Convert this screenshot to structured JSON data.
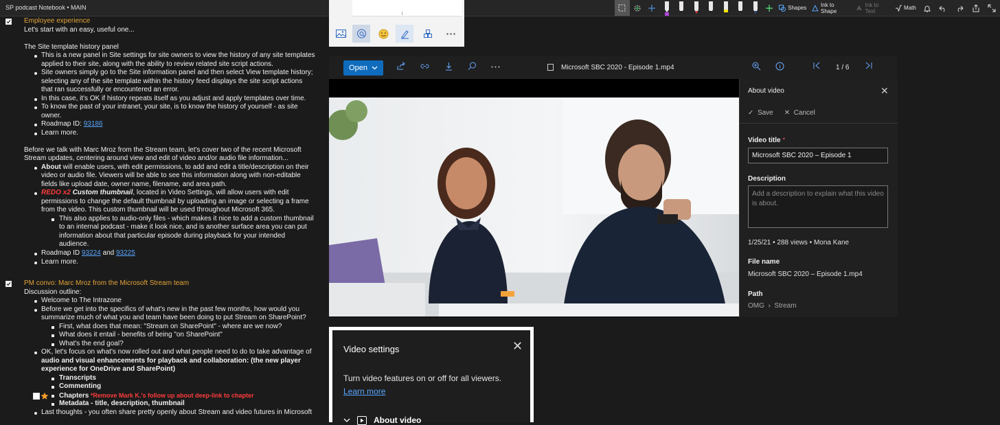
{
  "app": {
    "title": "SP podcast Notebook • MAIN",
    "toolbar": {
      "shapes_label": "Shapes",
      "ink_to_shape_label": "Ink to Shape",
      "ink_to_text_label": "Ink to Text",
      "math_label": "Math",
      "pen_colors": [
        "#111111",
        "#d62e2e",
        "#111111",
        "#f3e600",
        "#111111"
      ],
      "highlighter_color": "#b044d8",
      "icons": [
        "lasso-select-icon",
        "add-space-icon",
        "type-icon",
        "add-pen-icon",
        "shapes-icon",
        "ink-to-shape-icon",
        "ink-to-text-icon",
        "math-icon",
        "bell-icon",
        "undo-icon",
        "redo-icon",
        "share-icon",
        "expand-icon"
      ]
    }
  },
  "notes": {
    "section1_heading": "Employee experience",
    "l1": "Let's start with an easy, useful one...",
    "l2": "The Site template history panel",
    "l3": "This is a new panel in Site settings for site owners to view the history of any site templates",
    "l4": "applied to their site, along with the ability to review related site script actions.",
    "l5": "Site owners simply go to the Site information panel and then select View template history;",
    "l6": "selecting any of the site template within the history feed displays the site script actions",
    "l7": "that ran successfully or encountered an error.",
    "l8": "In this case, it's OK if history repeats itself as you adjust and apply templates over time.",
    "l9": "To know the past of your intranet, your site, is to know the history of yourself - as site",
    "l10": "owner.",
    "l11_prefix": "Roadmap ID: ",
    "l11_link": "93186",
    "l12": "Learn more.",
    "l13": "Before we talk with Marc Mroz from the Stream team, let's cover two of the recent Microsoft",
    "l14": "Stream updates, centering around view and edit of video and/or audio file information...",
    "l15_bold": "About",
    "l15_rest": " will enable users, with edit permissions, to add and edit a title/description on their",
    "l16": "video or audio file. Viewers will be able to see this information along with non-editable",
    "l17": "fields like upload date, owner name, filename, and area path.",
    "l18_red": "REDO x2",
    "l18_bold": " Custom thumbnail",
    "l18_rest": ", located in Video Settings, will allow users with edit",
    "l19": "permissions to change the default thumbnail by uploading an image or selecting a frame",
    "l20": "from the video. This custom thumbnail will be used throughout Microsoft 365.",
    "l21": "This also applies to audio-only files - which makes it nice to add a custom thumbnail",
    "l22": "to an internal podcast - make it look nice, and is another surface area you can put",
    "l23": "information about that particular episode during playback for your intended",
    "l24": "audience.",
    "l25_prefix": "Roadmap ID ",
    "l25_link1": "93224",
    "l25_mid": " and ",
    "l25_link2": "93225",
    "l26": "Learn more.",
    "section2_heading": "PM convo: Marc Mroz from the Microsoft Stream team",
    "m1": "Discussion outline:",
    "m2": "Welcome to The Intrazone",
    "m3": "Before we get into the specifics of what's new in the past few months, how would you",
    "m4": "summarize much of what you and team have been doing to put Stream on SharePoint?",
    "m5": "First, what does that mean: \"Stream on SharePoint\" - where are we now?",
    "m6": "What does it entail - benefits of being \"on SharePoint\"",
    "m7": "What's the end goal?",
    "m8": "OK, let's focus on what's now rolled out and what people need to do to take advantage of",
    "m9": "audio and visual enhancements for playback and collaboration: (the new player",
    "m10": "experience for OneDrive and SharePoint)",
    "m11": "Transcripts",
    "m12": "Commenting",
    "m13_bold": "Chapters",
    "m13_red": " *Remove Mark K.'s follow up about deep-link to chapter",
    "m14": "Metadata - title, description, thumbnail",
    "m15": "Last thoughts - you often share pretty openly about Stream and video futures in Microsoft"
  },
  "mini_toolbar": {
    "icons": [
      "image-icon",
      "chat-search-icon",
      "emoji-icon",
      "ink-pen-icon",
      "apps-icon",
      "more-icon"
    ]
  },
  "viewer": {
    "open_label": "Open",
    "file_title": "Microsoft SBC 2020 - Episode 1.mp4",
    "pager": "1 / 6",
    "about": {
      "header": "About video",
      "save_label": "Save",
      "cancel_label": "Cancel",
      "video_title_label": "Video title",
      "required_mark": "*",
      "video_title_value": "Microsoft SBC 2020 – Episode 1",
      "description_label": "Description",
      "description_placeholder": "Add a description to explain what this video is about.",
      "meta": "1/25/21 • 288 views • Mona Kane",
      "file_name_label": "File name",
      "file_name_value": "Microsoft SBC 2020 – Episode 1.mp4",
      "path_label": "Path",
      "path_part1": "OMG",
      "path_part2": "Stream"
    }
  },
  "video_settings": {
    "header": "Video settings",
    "description": "Turn video features on or off for all viewers.",
    "learn_more": "Learn more",
    "section_about": "About video"
  },
  "colors": {
    "accent": "#0f6cbd",
    "link": "#58a6ff",
    "heading_orange": "#e3a43a",
    "red_note": "#ff3b3b"
  }
}
